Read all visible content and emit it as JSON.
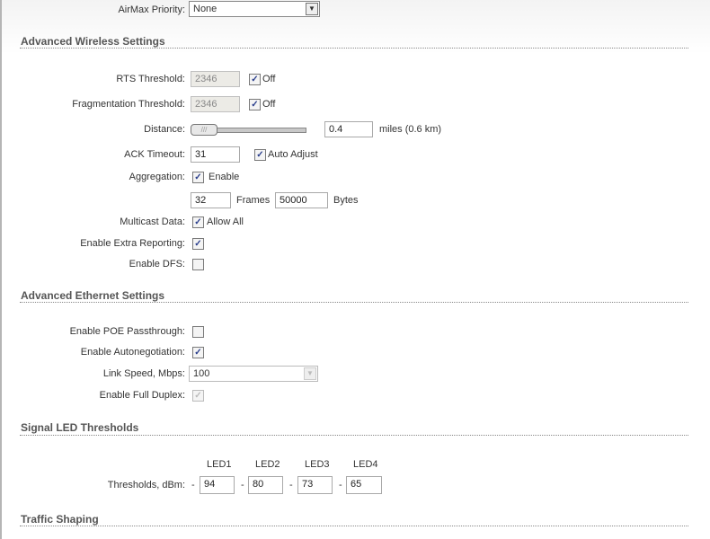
{
  "airmax": {
    "label": "AirMax Priority:",
    "value": "None"
  },
  "wireless": {
    "title": "Advanced Wireless Settings",
    "rts": {
      "label": "RTS Threshold:",
      "value": "2346",
      "off_label": "Off",
      "off_checked": true
    },
    "frag": {
      "label": "Fragmentation Threshold:",
      "value": "2346",
      "off_label": "Off",
      "off_checked": true
    },
    "distance": {
      "label": "Distance:",
      "value": "0.4",
      "unit": "miles (0.6 km)",
      "slider_fraction": 0.0
    },
    "ack": {
      "label": "ACK Timeout:",
      "value": "31",
      "auto_label": "Auto Adjust",
      "auto_checked": true
    },
    "aggregation": {
      "label": "Aggregation:",
      "enable_label": "Enable",
      "checked": true,
      "frames": "32",
      "frames_label": "Frames",
      "bytes": "50000",
      "bytes_label": "Bytes"
    },
    "multicast": {
      "label": "Multicast Data:",
      "allow_label": "Allow All",
      "checked": true
    },
    "extra": {
      "label": "Enable Extra Reporting:",
      "checked": true
    },
    "dfs": {
      "label": "Enable DFS:",
      "checked": false
    }
  },
  "ethernet": {
    "title": "Advanced Ethernet Settings",
    "poe": {
      "label": "Enable POE Passthrough:",
      "checked": false
    },
    "autoneg": {
      "label": "Enable Autonegotiation:",
      "checked": true
    },
    "speed": {
      "label": "Link Speed, Mbps:",
      "value": "100"
    },
    "duplex": {
      "label": "Enable Full Duplex:",
      "checked": true
    }
  },
  "led": {
    "title": "Signal LED Thresholds",
    "label": "Thresholds, dBm:",
    "dash": "-",
    "items": [
      {
        "name": "LED1",
        "value": "94"
      },
      {
        "name": "LED2",
        "value": "80"
      },
      {
        "name": "LED3",
        "value": "73"
      },
      {
        "name": "LED4",
        "value": "65"
      }
    ]
  },
  "traffic": {
    "title": "Traffic Shaping"
  }
}
